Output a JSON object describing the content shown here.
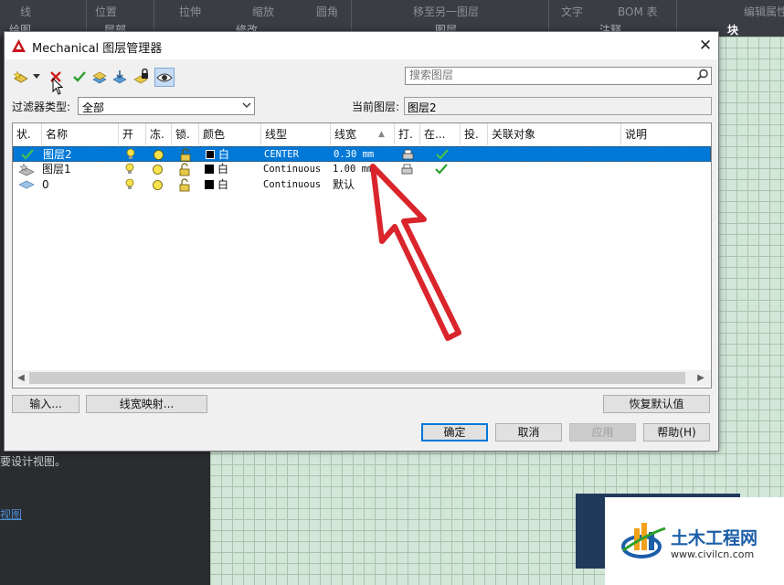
{
  "ribbon": {
    "items": [
      "线",
      "位置",
      "拉伸",
      "缩放",
      "圆角",
      "移至另一图层",
      "文字",
      "BOM 表",
      "编辑属性"
    ],
    "groups": [
      "绘图",
      "层部",
      "修改",
      "图层",
      "注释",
      "块"
    ]
  },
  "left_panel": {
    "text": "要设计视图。",
    "link": "视图"
  },
  "watermark": {
    "brand": "土木工程网",
    "url": "www.civilcn.com"
  },
  "dialog": {
    "title": "Mechanical 图层管理器",
    "close": "✕",
    "search_placeholder": "搜索图层",
    "filter_label": "过滤器类型:",
    "filter_value": "全部",
    "current_label": "当前图层:",
    "current_value": "图层2",
    "columns": [
      "状.",
      "名称",
      "开",
      "冻.",
      "锁.",
      "颜色",
      "线型",
      "线宽",
      "打.",
      "在...",
      "投.",
      "关联对象",
      "说明"
    ],
    "sort_indicator": "▲",
    "rows": [
      {
        "name": "图层2",
        "color": "白",
        "linetype": "CENTER",
        "lineweight": "0.30 mm",
        "selected": true
      },
      {
        "name": "图层1",
        "color": "白",
        "linetype": "Continuous",
        "lineweight": "1.00 mm",
        "selected": false
      },
      {
        "name": "0",
        "color": "白",
        "linetype": "Continuous",
        "lineweight": "默认",
        "selected": false
      }
    ],
    "buttons": {
      "input": "输入...",
      "lineweight_map": "线宽映射...",
      "restore_defaults": "恢复默认值",
      "ok": "确定",
      "cancel": "取消",
      "apply": "应用",
      "help": "帮助(H)"
    }
  },
  "colors": {
    "accent": "#0078d7",
    "annotation_arrow": "#d9252b",
    "check_green": "#2ca02c",
    "grid_bg": "#d3e7d8"
  }
}
